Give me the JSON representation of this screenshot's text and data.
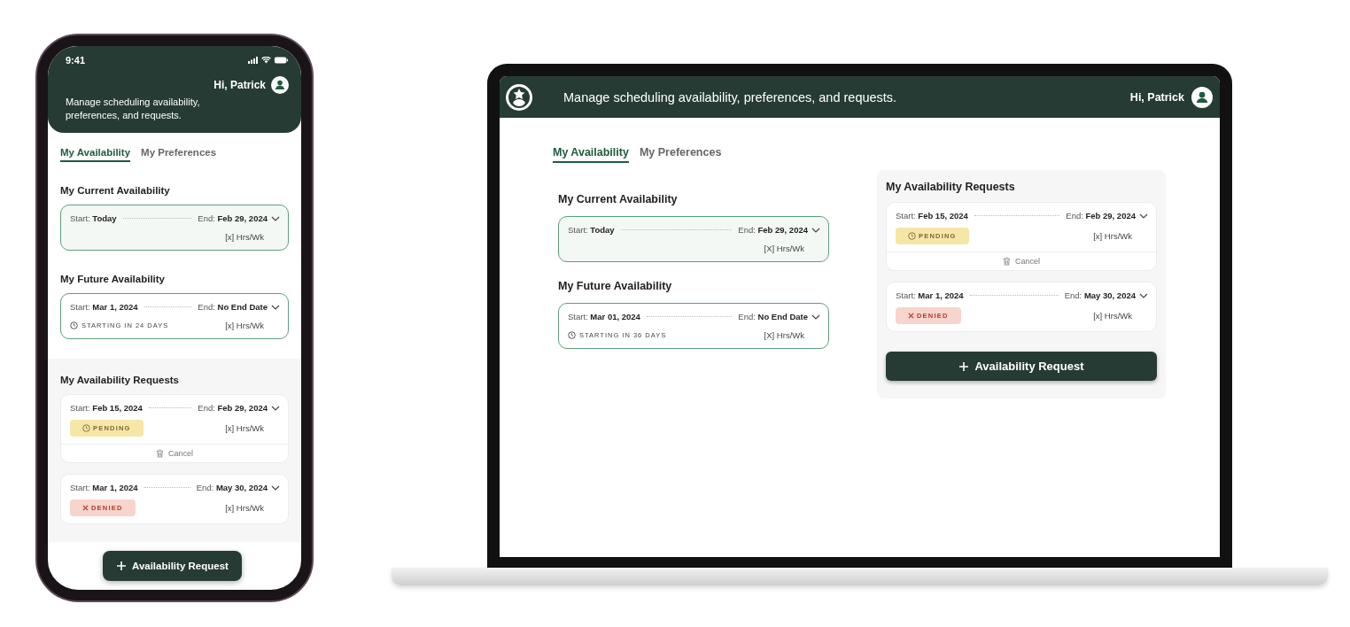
{
  "phone": {
    "status_bar": {
      "time": "9:41"
    },
    "greeting": "Hi,  Patrick",
    "subtitle": "Manage scheduling availability, preferences, and requests.",
    "tabs": [
      {
        "label": "My Availability",
        "selected": true
      },
      {
        "label": "My Preferences",
        "selected": false
      }
    ],
    "current": {
      "title": "My Current Availability",
      "cards": [
        {
          "highlighted": true,
          "start_label": "Start:",
          "start": "Today",
          "end_label": "End:",
          "end": "Feb 29, 2024",
          "hours": "[x] Hrs/Wk"
        }
      ]
    },
    "future": {
      "title": "My Future Availability",
      "cards": [
        {
          "highlighted": false,
          "start_label": "Start:",
          "start": "Mar 1, 2024",
          "end_label": "End:",
          "end": "No End Date",
          "hours": "[x] Hrs/Wk",
          "note": "STARTING IN 24 DAYS"
        }
      ]
    },
    "requests": {
      "title": "My Availability Requests",
      "cards": [
        {
          "highlighted": false,
          "start_label": "Start:",
          "start": "Feb 15, 2024",
          "end_label": "End:",
          "end": "Feb 29, 2024",
          "hours": "[x] Hrs/Wk",
          "status": {
            "kind": "pending",
            "label": "PENDING"
          },
          "action": "Cancel"
        },
        {
          "highlighted": false,
          "start_label": "Start:",
          "start": "Mar 1, 2024",
          "end_label": "End:",
          "end": "May 30, 2024",
          "hours": "[x] Hrs/Wk",
          "status": {
            "kind": "denied",
            "label": "DENIED"
          }
        }
      ]
    },
    "action_button": "Availability Request"
  },
  "laptop": {
    "subtitle": "Manage scheduling availability, preferences, and requests.",
    "greeting": "Hi,  Patrick",
    "tabs": [
      {
        "label": "My Availability",
        "selected": true
      },
      {
        "label": "My Preferences",
        "selected": false
      }
    ],
    "current": {
      "title": "My Current Availability",
      "cards": [
        {
          "highlighted": true,
          "start_label": "Start:",
          "start": "Today",
          "end_label": "End:",
          "end": "Feb 29, 2024",
          "hours": "[X] Hrs/Wk"
        }
      ]
    },
    "future": {
      "title": "My Future Availability",
      "cards": [
        {
          "highlighted": false,
          "start_label": "Start:",
          "start": "Mar 01, 2024",
          "end_label": "End:",
          "end": "No End Date",
          "hours": "[X] Hrs/Wk",
          "note": "STARTING IN 36 DAYS"
        }
      ]
    },
    "requests": {
      "title": "My Availability Requests",
      "cards": [
        {
          "highlighted": false,
          "start_label": "Start:",
          "start": "Feb 15, 2024",
          "end_label": "End:",
          "end": "Feb 29, 2024",
          "hours": "[x] Hrs/Wk",
          "status": {
            "kind": "pending",
            "label": "PENDING"
          },
          "action": "Cancel"
        },
        {
          "highlighted": false,
          "start_label": "Start:",
          "start": "Mar 1, 2024",
          "end_label": "End:",
          "end": "May 30, 2024",
          "hours": "[x] Hrs/Wk",
          "status": {
            "kind": "denied",
            "label": "DENIED"
          }
        }
      ]
    },
    "action_button": "Availability Request"
  }
}
